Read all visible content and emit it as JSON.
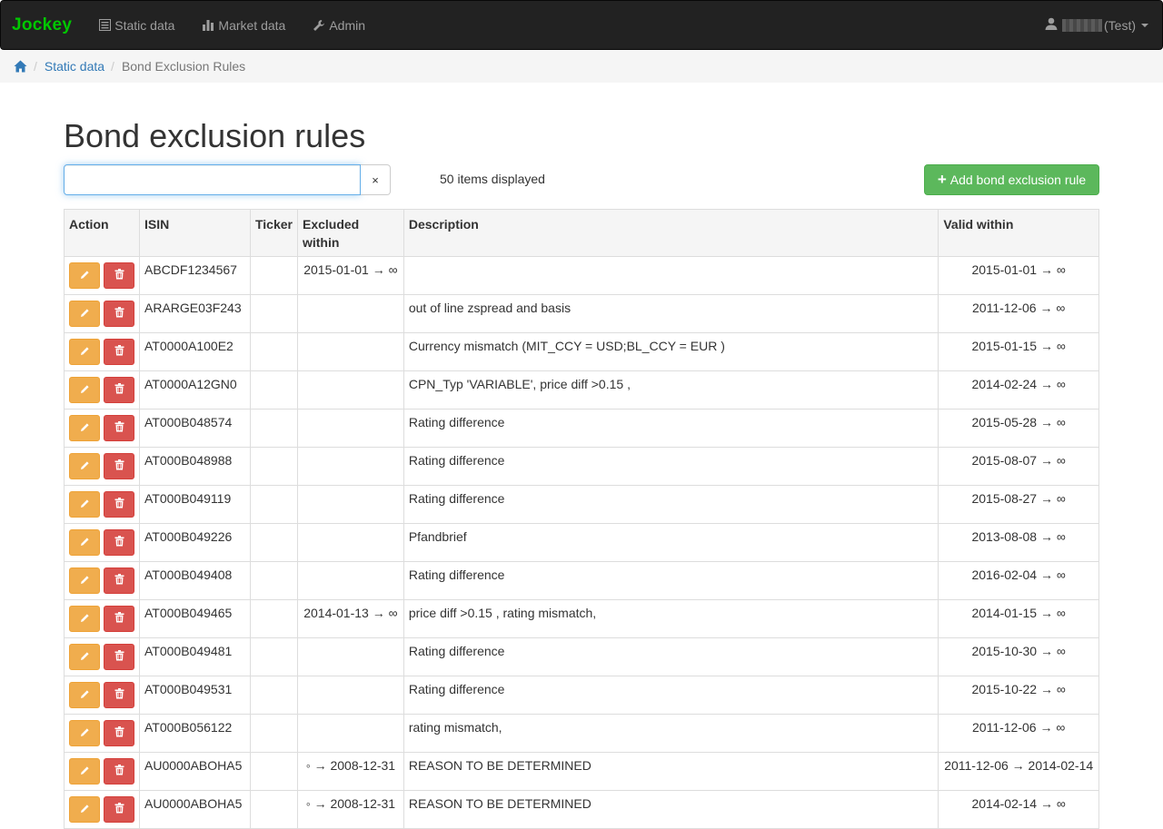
{
  "nav": {
    "brand": "Jockey",
    "items": [
      {
        "label": "Static data",
        "icon": "list-icon"
      },
      {
        "label": "Market data",
        "icon": "bar-chart-icon"
      },
      {
        "label": "Admin",
        "icon": "wrench-icon"
      }
    ],
    "user_suffix": "(Test)"
  },
  "breadcrumb": {
    "items": [
      "Static data",
      "Bond Exclusion Rules"
    ]
  },
  "page": {
    "title": "Bond exclusion rules",
    "search_value": "",
    "clear_label": "×",
    "count_text": "50 items displayed",
    "add_label": "Add bond exclusion rule"
  },
  "table": {
    "headers": [
      "Action",
      "ISIN",
      "Ticker",
      "Excluded within",
      "Description",
      "Valid within"
    ],
    "rows": [
      {
        "isin": "ABCDF1234567",
        "ticker": "",
        "excluded": "2015-01-01 → ∞",
        "description": "",
        "valid": "2015-01-01 → ∞"
      },
      {
        "isin": "ARARGE03F243",
        "ticker": "",
        "excluded": "",
        "description": "out of line zspread and basis",
        "valid": "2011-12-06 → ∞"
      },
      {
        "isin": "AT0000A100E2",
        "ticker": "",
        "excluded": "",
        "description": "Currency mismatch (MIT_CCY = USD;BL_CCY = EUR )",
        "valid": "2015-01-15 → ∞"
      },
      {
        "isin": "AT0000A12GN0",
        "ticker": "",
        "excluded": "",
        "description": "CPN_Typ 'VARIABLE', price diff >0.15 ,",
        "valid": "2014-02-24 → ∞"
      },
      {
        "isin": "AT000B048574",
        "ticker": "",
        "excluded": "",
        "description": "Rating difference",
        "valid": "2015-05-28 → ∞"
      },
      {
        "isin": "AT000B048988",
        "ticker": "",
        "excluded": "",
        "description": "Rating difference",
        "valid": "2015-08-07 → ∞"
      },
      {
        "isin": "AT000B049119",
        "ticker": "",
        "excluded": "",
        "description": "Rating difference",
        "valid": "2015-08-27 → ∞"
      },
      {
        "isin": "AT000B049226",
        "ticker": "",
        "excluded": "",
        "description": "Pfandbrief",
        "valid": "2013-08-08 → ∞"
      },
      {
        "isin": "AT000B049408",
        "ticker": "",
        "excluded": "",
        "description": "Rating difference",
        "valid": "2016-02-04 → ∞"
      },
      {
        "isin": "AT000B049465",
        "ticker": "",
        "excluded": "2014-01-13 → ∞",
        "description": "price diff >0.15 , rating mismatch,",
        "valid": "2014-01-15 → ∞"
      },
      {
        "isin": "AT000B049481",
        "ticker": "",
        "excluded": "",
        "description": "Rating difference",
        "valid": "2015-10-30 → ∞"
      },
      {
        "isin": "AT000B049531",
        "ticker": "",
        "excluded": "",
        "description": "Rating difference",
        "valid": "2015-10-22 → ∞"
      },
      {
        "isin": "AT000B056122",
        "ticker": "",
        "excluded": "",
        "description": "rating mismatch,",
        "valid": "2011-12-06 → ∞"
      },
      {
        "isin": "AU0000ABOHA5",
        "ticker": "",
        "excluded": "◦ → 2008-12-31",
        "description": "REASON TO BE DETERMINED",
        "valid": "2011-12-06 → 2014-02-14"
      },
      {
        "isin": "AU0000ABOHA5",
        "ticker": "",
        "excluded": "◦ → 2008-12-31",
        "description": "REASON TO BE DETERMINED",
        "valid": "2014-02-14 → ∞"
      }
    ]
  },
  "colors": {
    "navbar": "#222222",
    "brand": "#00c800",
    "edit": "#f0ad4e",
    "delete": "#d9534f",
    "add": "#5cb85c",
    "link": "#337ab7"
  }
}
